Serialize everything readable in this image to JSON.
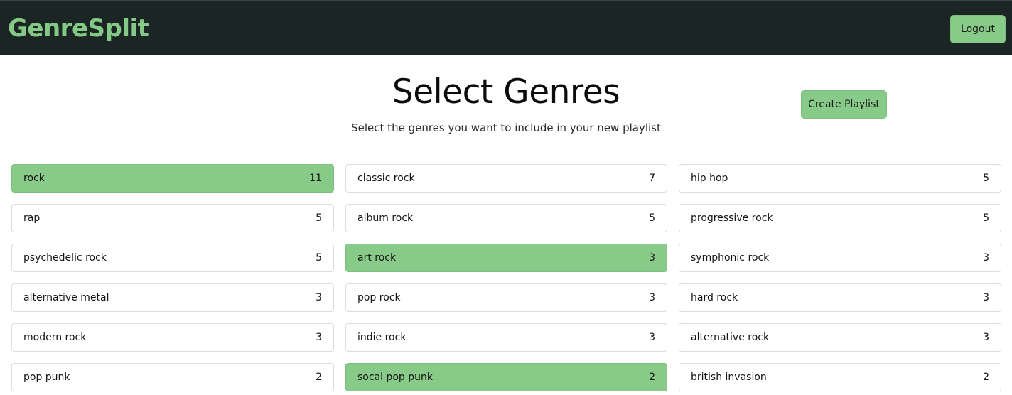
{
  "app": {
    "brand": "GenreSplit",
    "logout_label": "Logout",
    "accent_color": "#88ca88",
    "navbar_color": "#1b2524"
  },
  "main": {
    "title": "Select Genres",
    "subtitle": "Select the genres you want to include in your new playlist",
    "create_label": "Create Playlist"
  },
  "genres": [
    {
      "name": "rock",
      "count": "11",
      "selected": true
    },
    {
      "name": "classic rock",
      "count": "7",
      "selected": false
    },
    {
      "name": "hip hop",
      "count": "5",
      "selected": false
    },
    {
      "name": "rap",
      "count": "5",
      "selected": false
    },
    {
      "name": "album rock",
      "count": "5",
      "selected": false
    },
    {
      "name": "progressive rock",
      "count": "5",
      "selected": false
    },
    {
      "name": "psychedelic rock",
      "count": "5",
      "selected": false
    },
    {
      "name": "art rock",
      "count": "3",
      "selected": true
    },
    {
      "name": "symphonic rock",
      "count": "3",
      "selected": false
    },
    {
      "name": "alternative metal",
      "count": "3",
      "selected": false
    },
    {
      "name": "pop rock",
      "count": "3",
      "selected": false
    },
    {
      "name": "hard rock",
      "count": "3",
      "selected": false
    },
    {
      "name": "modern rock",
      "count": "3",
      "selected": false
    },
    {
      "name": "indie rock",
      "count": "3",
      "selected": false
    },
    {
      "name": "alternative rock",
      "count": "3",
      "selected": false
    },
    {
      "name": "pop punk",
      "count": "2",
      "selected": false
    },
    {
      "name": "socal pop punk",
      "count": "2",
      "selected": true
    },
    {
      "name": "british invasion",
      "count": "2",
      "selected": false
    }
  ]
}
